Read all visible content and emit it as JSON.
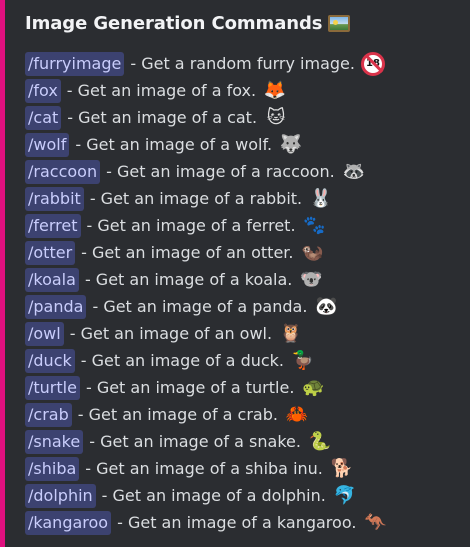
{
  "embed": {
    "accent_color": "#e0107f",
    "title": "Image Generation Commands",
    "title_icon": "framed-picture-icon",
    "commands": [
      {
        "cmd": "/furryimage",
        "desc": "- Get a random furry image.",
        "icon": "no-one-under-eighteen-icon",
        "glyph": "18"
      },
      {
        "cmd": "/fox",
        "desc": "- Get an image of a fox.",
        "icon": "fox-icon",
        "glyph": "🦊"
      },
      {
        "cmd": "/cat",
        "desc": "- Get an image of a cat.",
        "icon": "cat-face-icon",
        "glyph": "🐱"
      },
      {
        "cmd": "/wolf",
        "desc": "- Get an image of a wolf.",
        "icon": "wolf-icon",
        "glyph": "🐺"
      },
      {
        "cmd": "/raccoon",
        "desc": "- Get an image of a raccoon.",
        "icon": "raccoon-icon",
        "glyph": "🦝"
      },
      {
        "cmd": "/rabbit",
        "desc": "- Get an image of a rabbit.",
        "icon": "rabbit-face-icon",
        "glyph": "🐰"
      },
      {
        "cmd": "/ferret",
        "desc": "- Get an image of a ferret.",
        "icon": "paw-prints-icon",
        "glyph": "🐾"
      },
      {
        "cmd": "/otter",
        "desc": "- Get an image of an otter.",
        "icon": "otter-icon",
        "glyph": "🦦"
      },
      {
        "cmd": "/koala",
        "desc": "- Get an image of a koala.",
        "icon": "koala-icon",
        "glyph": "🐨"
      },
      {
        "cmd": "/panda",
        "desc": "- Get an image of a panda.",
        "icon": "panda-icon",
        "glyph": "🐼"
      },
      {
        "cmd": "/owl",
        "desc": "- Get an image of an owl.",
        "icon": "owl-icon",
        "glyph": "🦉"
      },
      {
        "cmd": "/duck",
        "desc": "- Get an image of a duck.",
        "icon": "duck-icon",
        "glyph": "🦆"
      },
      {
        "cmd": "/turtle",
        "desc": "- Get an image of a turtle.",
        "icon": "turtle-icon",
        "glyph": "🐢"
      },
      {
        "cmd": "/crab",
        "desc": "- Get an image of a crab.",
        "icon": "crab-icon",
        "glyph": "🦀"
      },
      {
        "cmd": "/snake",
        "desc": "- Get an image of a snake.",
        "icon": "snake-icon",
        "glyph": "🐍"
      },
      {
        "cmd": "/shiba",
        "desc": "- Get an image of a shiba inu.",
        "icon": "dog-icon",
        "glyph": "🐕"
      },
      {
        "cmd": "/dolphin",
        "desc": "- Get an image of a dolphin.",
        "icon": "dolphin-icon",
        "glyph": "🐬"
      },
      {
        "cmd": "/kangaroo",
        "desc": "- Get an image of a kangaroo.",
        "icon": "kangaroo-icon",
        "glyph": "🦘"
      }
    ]
  }
}
